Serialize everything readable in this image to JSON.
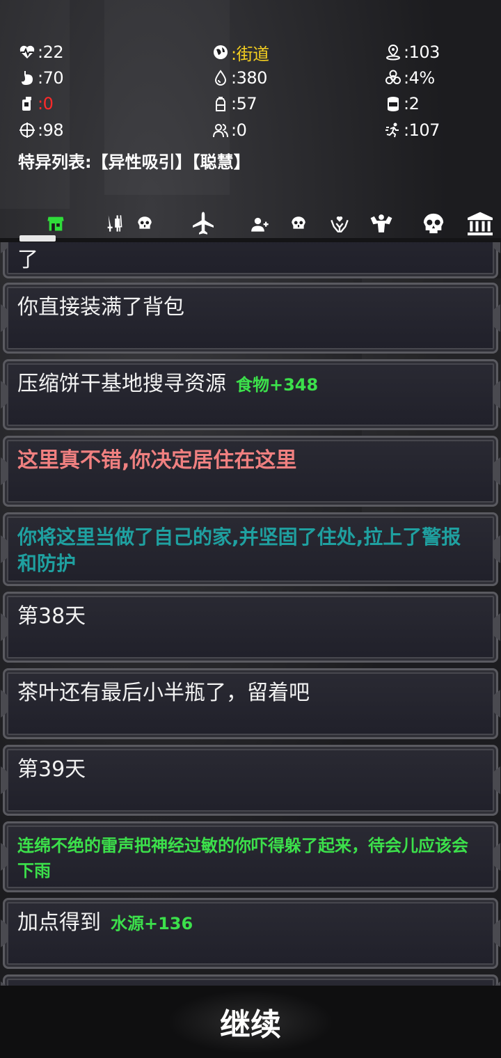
{
  "stats": {
    "health": ":22",
    "location": ":街道",
    "distance": ":103",
    "hunger": ":70",
    "water": ":380",
    "infection": ":4%",
    "drink": ":0",
    "bottle": ":57",
    "food_can": ":2",
    "aim": ":98",
    "companions": ":0",
    "speed": ":107"
  },
  "traits": "特异列表:【异性吸引】【聪慧】",
  "tabs": [
    {
      "icon": "shop-icon"
    },
    {
      "icon": "weapons-icon"
    },
    {
      "icon": "skull-small-icon"
    },
    {
      "icon": "plane-icon"
    },
    {
      "icon": "add-user-icon"
    },
    {
      "icon": "skull-small-icon"
    },
    {
      "icon": "heart-hand-icon"
    },
    {
      "icon": "strength-icon"
    },
    {
      "icon": "skull-large-icon"
    },
    {
      "icon": "bank-icon"
    }
  ],
  "log": [
    {
      "text": "了"
    },
    {
      "text": "你直接装满了背包"
    },
    {
      "text": "压缩饼干基地搜寻资源",
      "gain": "食物+348"
    },
    {
      "text": "这里真不错,你决定居住在这里"
    },
    {
      "text": "你将这里当做了自己的家,并坚固了住处,拉上了警报和防护"
    },
    {
      "text": "第38天"
    },
    {
      "text": "茶叶还有最后小半瓶了，留着吧"
    },
    {
      "text": "第39天"
    },
    {
      "text": "连绵不绝的雷声把神经过敏的你吓得躲了起来，待会儿应该会下雨"
    },
    {
      "text": "加点得到",
      "gain": "水源+136"
    }
  ],
  "continue_label": "继续",
  "colors": {
    "location": "#f5d020",
    "drink_zero": "#ff2a2a",
    "gain": "#3ce04b",
    "red_text": "#f08080",
    "teal_text": "#1fa0a0"
  }
}
